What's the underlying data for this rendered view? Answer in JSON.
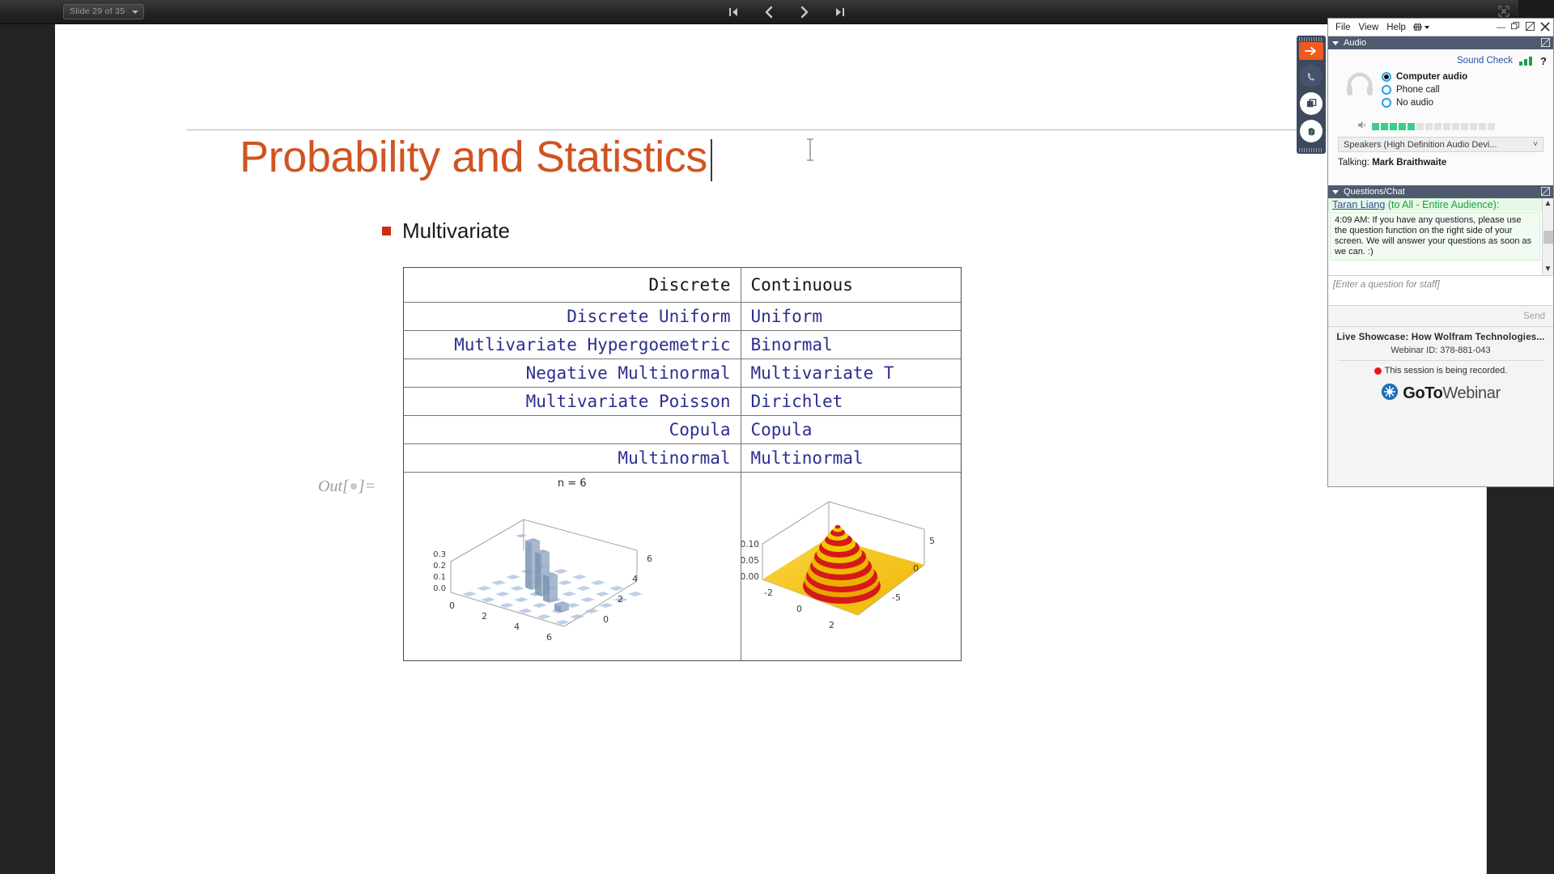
{
  "viewer": {
    "slide_selector": "Slide 29 of 35",
    "nav": [
      {
        "name": "first-slide",
        "label": "|<"
      },
      {
        "name": "previous-slide",
        "label": "<"
      },
      {
        "name": "next-slide",
        "label": ">"
      },
      {
        "name": "last-slide",
        "label": ">|"
      }
    ],
    "close_label": "×"
  },
  "slide": {
    "title": "Probability and Statistics",
    "bullet": "Multivariate",
    "out_label_prefix": "Out[",
    "out_label_suffix": "]=",
    "table": {
      "headers": [
        "Discrete",
        "Continuous"
      ],
      "rows": [
        [
          "Discrete Uniform",
          "Uniform"
        ],
        [
          "Mutlivariate Hypergoemetric",
          "Binormal"
        ],
        [
          "Negative Multinormal",
          "Multivariate T"
        ],
        [
          "Multivariate Poisson",
          "Dirichlet"
        ],
        [
          "Copula",
          "Copula"
        ],
        [
          "Multinormal",
          "Multinormal"
        ]
      ],
      "plots": {
        "discrete": {
          "title": "n = 6",
          "z_ticks": [
            "0.3",
            "0.2",
            "0.1",
            "0.0"
          ],
          "x_ticks": [
            "0",
            "2",
            "4",
            "6"
          ],
          "y_ticks": [
            "6",
            "4",
            "2",
            "0"
          ]
        },
        "continuous": {
          "title": "",
          "z_ticks": [
            "0.10",
            "0.05",
            "0.00"
          ],
          "x_ticks": [
            "-2",
            "0",
            "2"
          ],
          "y_ticks": [
            "5",
            "0",
            "-5"
          ]
        }
      }
    },
    "colors": {
      "title": "#cf5421",
      "bullet": "#d02b14",
      "table_text": "#2b2f8f"
    }
  },
  "control_strip": {
    "items": [
      {
        "name": "collapse-panel-button",
        "icon": "arrow-right-icon"
      },
      {
        "name": "phone-button",
        "icon": "phone-icon"
      },
      {
        "name": "screen-share-button",
        "icon": "screen-share-icon"
      },
      {
        "name": "raise-hand-button",
        "icon": "raise-hand-icon"
      }
    ]
  },
  "gtw": {
    "menu": [
      "File",
      "View",
      "Help"
    ],
    "window_controls": [
      "minimize",
      "restore",
      "undock",
      "close"
    ],
    "audio": {
      "section_title": "Audio",
      "sound_check": "Sound Check",
      "help": "?",
      "options": [
        {
          "label": "Computer audio",
          "selected": true
        },
        {
          "label": "Phone call",
          "selected": false
        },
        {
          "label": "No audio",
          "selected": false
        }
      ],
      "volume_level": 5,
      "volume_total": 14,
      "device": "Speakers (High Definition Audio Devi...",
      "talking_label": "Talking:",
      "talking_name": "Mark Braithwaite"
    },
    "chat": {
      "section_title": "Questions/Chat",
      "sender": "Taran Liang",
      "sender_scope": "(to All - Entire Audience):",
      "message": "4:09 AM: If you have any questions, please use the question function on the right side of your screen. We will answer your questions as soon as we can. :)",
      "input_placeholder": "[Enter a question for staff]",
      "send_label": "Send"
    },
    "footer": {
      "webinar_title": "Live Showcase: How Wolfram Technologies...",
      "webinar_id": "Webinar ID: 378-881-043",
      "recording_notice": "This session is being recorded.",
      "logo_bold": "GoTo",
      "logo_light": "Webinar"
    }
  }
}
